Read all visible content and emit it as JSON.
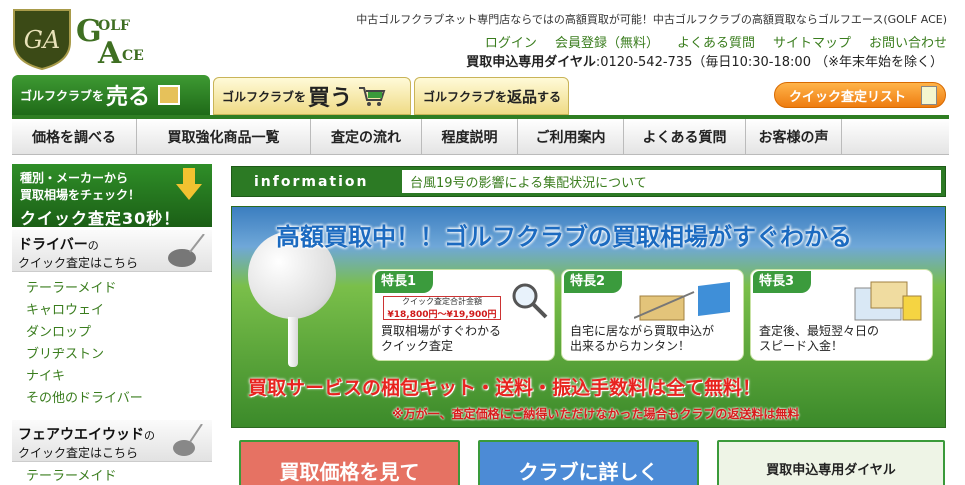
{
  "logo": {
    "shield_text": "GA",
    "word1": "OLF",
    "word2": "CE"
  },
  "header": {
    "tagline": "中古ゴルフクラブネット専門店ならではの高額買取が可能！中古ゴルフクラブの高額買取ならゴルフエース(GOLF ACE)",
    "links": [
      "ログイン",
      "会員登録（無料）",
      "よくある質問",
      "サイトマップ",
      "お問い合わせ"
    ],
    "dial_label": "買取申込専用ダイヤル",
    "dial_text": ":0120-542-735（毎日10:30-18:00 （※年末年始を除く）"
  },
  "tabs": {
    "sell_small": "ゴルフクラブを",
    "sell_big": "売る",
    "buy_small": "ゴルフクラブを",
    "buy_big": "買う",
    "ret_small": "ゴルフクラブを",
    "ret_big": "返品",
    "ret_suffix": "する"
  },
  "quick_list_button": "クイック査定リスト",
  "nav": [
    "価格を調べる",
    "買取強化商品一覧",
    "査定の流れ",
    "程度説明",
    "ご利用案内",
    "よくある質問",
    "お客様の声"
  ],
  "sidebar": {
    "banner_l1": "種別・メーカーから",
    "banner_l2": "買取相場をチェック！",
    "banner_l3": "クイック査定30秒！",
    "driver_title": "ドライバー",
    "driver_suffix": "の",
    "driver_sub": "クイック査定はこちら",
    "driver_items": [
      "テーラーメイド",
      "キャロウェイ",
      "ダンロップ",
      "ブリヂストン",
      "ナイキ",
      "その他のドライバー"
    ],
    "fw_title": "フェアウエイウッド",
    "fw_suffix": "の",
    "fw_sub": "クイック査定はこちら",
    "fw_items": [
      "テーラーメイド"
    ]
  },
  "info": {
    "label": "information",
    "text": "台風19号の影響による集配状況について"
  },
  "hero": {
    "title": "高額買取中！！ゴルフクラブの買取相場がすぐわかる",
    "features": [
      {
        "tag": "特長1",
        "line1": "買取相場がすぐわかる",
        "line2": "クイック査定"
      },
      {
        "tag": "特長2",
        "line1": "自宅に居ながら買取申込が",
        "line2": "出来るからカンタン！"
      },
      {
        "tag": "特長3",
        "line1": "査定後、最短翌々日の",
        "line2": "スピード入金！"
      }
    ],
    "price_label": "クイック査定合計金額",
    "price_value": "¥18,800円〜¥19,900円",
    "band": "買取サービスの梱包キット・送料・振込手数料は全て無料！",
    "note": "※万が一、査定価格にご納得いただけなかった場合もクラブの返送料は無料"
  },
  "cards": {
    "c1": "買取価格を見て",
    "c2": "クラブに詳しく",
    "c3": "買取申込専用ダイヤル"
  },
  "colors": {
    "brand_green": "#2c7a24",
    "link_green": "#3a7d1e",
    "accent_orange": "#ee7c10",
    "red": "#e8231f"
  }
}
